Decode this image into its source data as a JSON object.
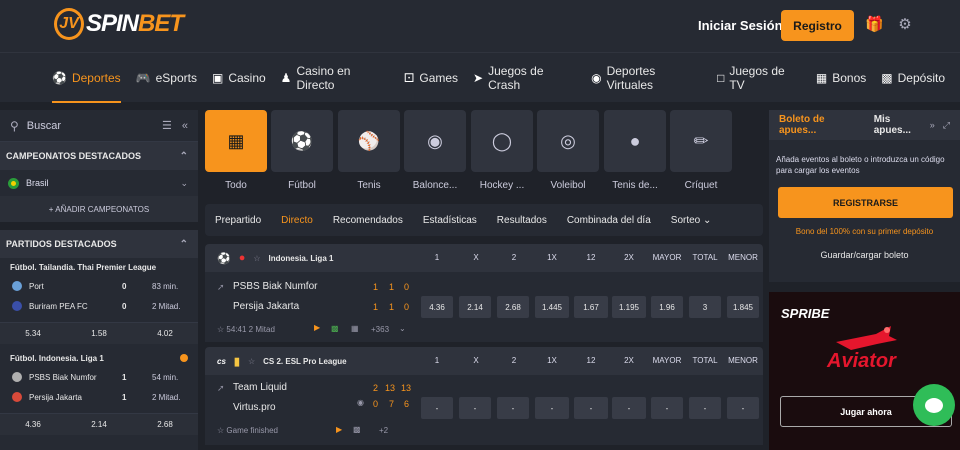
{
  "header": {
    "login_label": "Iniciar Sesión",
    "register_label": "Registro",
    "brand_color": "#f7941d"
  },
  "nav": [
    {
      "label": "Deportes",
      "icon": "soccer-icon",
      "active": true
    },
    {
      "label": "eSports",
      "icon": "gamepad-icon"
    },
    {
      "label": "Casino",
      "icon": "slot-icon"
    },
    {
      "label": "Casino en Directo",
      "icon": "dealer-icon"
    },
    {
      "label": "Games",
      "icon": "dice-icon"
    },
    {
      "label": "Juegos de Crash",
      "icon": "rocket-icon"
    },
    {
      "label": "Deportes Virtuales",
      "icon": "controller-icon"
    },
    {
      "label": "Juegos de TV",
      "icon": "cards-icon"
    },
    {
      "label": "Bonos",
      "icon": "gift-icon"
    },
    {
      "label": "Depósito",
      "icon": "wallet-icon"
    }
  ],
  "sidebar": {
    "search_placeholder": "Buscar",
    "featured_champs_title": "CAMPEONATOS DESTACADOS",
    "country": "Brasil",
    "add_champs": "+ AÑADIR CAMPEONATOS",
    "featured_matches_title": "PARTIDOS DESTACADOS",
    "matches": [
      {
        "league": "Fútbol. Tailandia. Thai Premier League",
        "team1": "Port",
        "score1": "0",
        "time1": "83 min.",
        "team2": "Buriram PEA FC",
        "score2": "0",
        "time2": "2 Mitad.",
        "odds": [
          "5.34",
          "1.58",
          "4.02"
        ]
      },
      {
        "league": "Fútbol. Indonesia. Liga 1",
        "team1": "PSBS Biak Numfor",
        "score1": "1",
        "time1": "54 min.",
        "team2": "Persija Jakarta",
        "score2": "1",
        "time2": "2 Mitad.",
        "odds": [
          "4.36",
          "2.14",
          "2.68"
        ]
      }
    ]
  },
  "sports": [
    {
      "label": "Todo",
      "active": true
    },
    {
      "label": "Fútbol"
    },
    {
      "label": "Tenis"
    },
    {
      "label": "Balonce..."
    },
    {
      "label": "Hockey ..."
    },
    {
      "label": "Voleibol"
    },
    {
      "label": "Tenis de..."
    },
    {
      "label": "Críquet"
    }
  ],
  "tabs": [
    {
      "label": "Prepartido"
    },
    {
      "label": "Directo",
      "active": true
    },
    {
      "label": "Recomendados"
    },
    {
      "label": "Estadísticas"
    },
    {
      "label": "Resultados"
    },
    {
      "label": "Combinada del día"
    },
    {
      "label": "Sorteo"
    }
  ],
  "columns": [
    "1",
    "X",
    "2",
    "1X",
    "12",
    "2X",
    "MAYOR",
    "TOTAL",
    "MENOR"
  ],
  "events": [
    {
      "league": "Indonesia. Liga 1",
      "team1": "PSBS Biak Numfor",
      "team2": "Persija Jakarta",
      "scores1": [
        "1",
        "1",
        "0"
      ],
      "scores2": [
        "1",
        "1",
        "0"
      ],
      "time": "54:41",
      "period": "2 Mitad",
      "more": "+363",
      "odds": [
        "4.36",
        "2.14",
        "2.68",
        "1.445",
        "1.67",
        "1.195",
        "1.96",
        "3",
        "1.845"
      ]
    },
    {
      "league": "CS 2. ESL Pro League",
      "team1": "Team Liquid",
      "team2": "Virtus.pro",
      "scores1": [
        "2",
        "13",
        "13"
      ],
      "scores2": [
        "0",
        "7",
        "6"
      ],
      "time": "Game finished",
      "more": "+2",
      "odds": [
        "-",
        "-",
        "-",
        "-",
        "-",
        "-",
        "-",
        "-",
        "-"
      ]
    }
  ],
  "betslip": {
    "tab1": "Boleto de apues...",
    "tab2": "Mis apues...",
    "text": "Añada eventos al boleto o introduzca un código para cargar los eventos",
    "register": "REGISTRARSE",
    "bonus": "Bono del 100% con su primer depósito",
    "load": "Guardar/cargar boleto"
  },
  "promo": {
    "brand": "SPRIBE",
    "game": "Aviator",
    "play": "Jugar ahora"
  }
}
